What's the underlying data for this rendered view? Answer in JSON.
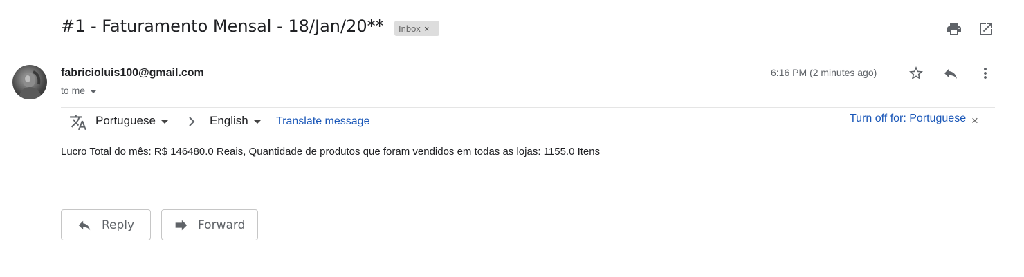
{
  "email": {
    "subject": "#1 - Faturamento Mensal - 18/Jan/20**",
    "label_chip": "Inbox",
    "label_remove": "×",
    "sender": "fabricioluis100@gmail.com",
    "recipient": "to me",
    "time": "6:16 PM (2 minutes ago)",
    "body": "Lucro Total do mês: R$ 146480.0 Reais, Quantidade de produtos que foram vendidos em todas as lojas: 1155.0 Itens"
  },
  "translate": {
    "from_lang": "Portuguese",
    "to_lang": "English",
    "action": "Translate message",
    "turn_off": "Turn off for: Portuguese",
    "close": "×"
  },
  "actions": {
    "reply": "Reply",
    "forward": "Forward"
  },
  "icons": [
    "print-icon",
    "open-new-window-icon",
    "star-icon",
    "reply-icon",
    "more-vert-icon",
    "translate-icon",
    "chevron-right-icon",
    "close-icon"
  ],
  "colors": {
    "link": "#1a57b8",
    "muted": "#5f6368",
    "chip_bg": "#dddddd"
  }
}
